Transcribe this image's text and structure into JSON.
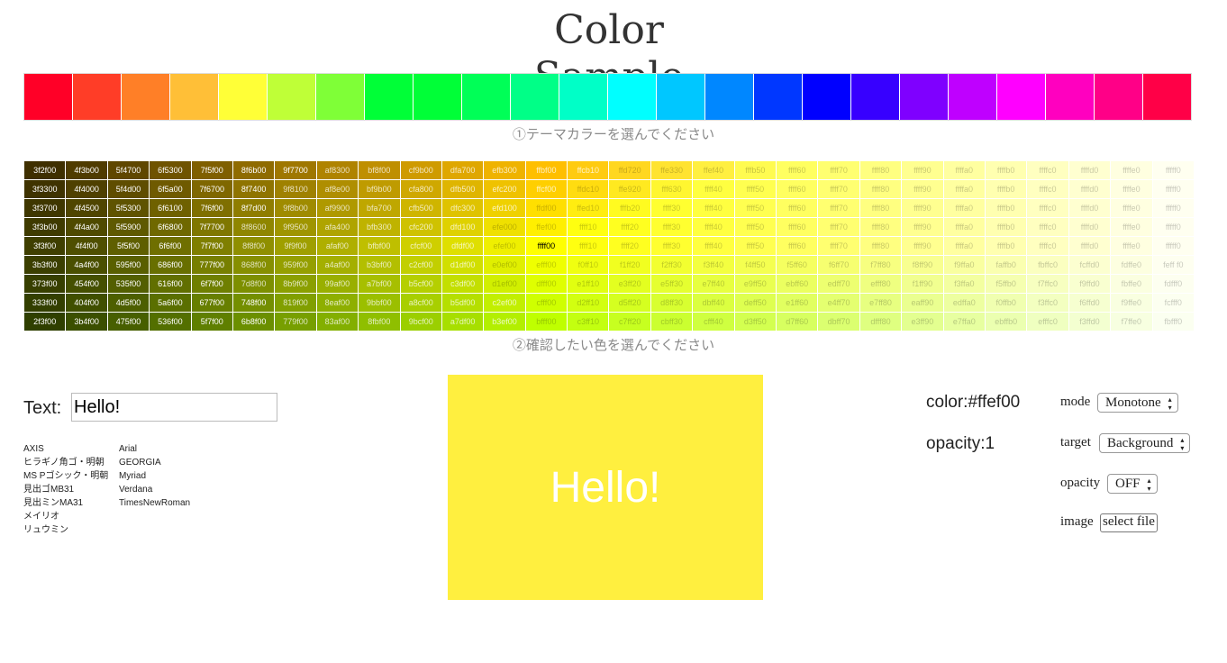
{
  "title": "Color Sample",
  "theme_caption": "①テーマカラーを選んでください",
  "grid_caption": "②確認したい色を選んでください",
  "theme_colors": [
    "#ff0027",
    "#ff3d27",
    "#ff7f27",
    "#ffbf37",
    "#ffff37",
    "#bfff37",
    "#7fff37",
    "#00ff37",
    "#00ff37",
    "#00ff57",
    "#00ff87",
    "#00ffc7",
    "#00ffff",
    "#00c7ff",
    "#0087ff",
    "#0037ff",
    "#0000ff",
    "#3700ff",
    "#7f00ff",
    "#bf00ff",
    "#ff00ff",
    "#ff00bf",
    "#ff0087",
    "#ff0047"
  ],
  "grid_rows": [
    [
      "3f2f00",
      "4f3b00",
      "5f4700",
      "6f5300",
      "7f5f00",
      "8f6b00",
      "9f7700",
      "af8300",
      "bf8f00",
      "cf9b00",
      "dfa700",
      "efb300",
      "ffbf00",
      "ffcb10",
      "ffd720",
      "ffe330",
      "ffef40",
      "fffb50",
      "ffff60",
      "ffff70",
      "ffff80",
      "ffff90",
      "ffffa0",
      "ffffb0",
      "ffffc0",
      "ffffd0",
      "ffffe0",
      "fffff0"
    ],
    [
      "3f3300",
      "4f4000",
      "5f4d00",
      "6f5a00",
      "7f6700",
      "8f7400",
      "9f8100",
      "af8e00",
      "bf9b00",
      "cfa800",
      "dfb500",
      "efc200",
      "ffcf00",
      "ffdc10",
      "ffe920",
      "fff630",
      "ffff40",
      "ffff50",
      "ffff60",
      "ffff70",
      "ffff80",
      "ffff90",
      "ffffa0",
      "ffffb0",
      "ffffc0",
      "ffffd0",
      "ffffe0",
      "fffff0"
    ],
    [
      "3f3700",
      "4f4500",
      "5f5300",
      "6f6100",
      "7f6f00",
      "8f7d00",
      "9f8b00",
      "af9900",
      "bfa700",
      "cfb500",
      "dfc300",
      "efd100",
      "ffdf00",
      "ffed10",
      "fffb20",
      "ffff30",
      "ffff40",
      "ffff50",
      "ffff60",
      "ffff70",
      "ffff80",
      "ffff90",
      "ffffa0",
      "ffffb0",
      "ffffc0",
      "ffffd0",
      "ffffe0",
      "fffff0"
    ],
    [
      "3f3b00",
      "4f4a00",
      "5f5900",
      "6f6800",
      "7f7700",
      "8f8600",
      "9f9500",
      "afa400",
      "bfb300",
      "cfc200",
      "dfd100",
      "efe000",
      "ffef00",
      "ffff10",
      "ffff20",
      "ffff30",
      "ffff40",
      "ffff50",
      "ffff60",
      "ffff70",
      "ffff80",
      "ffff90",
      "ffffa0",
      "ffffb0",
      "ffffc0",
      "ffffd0",
      "ffffe0",
      "fffff0"
    ],
    [
      "3f3f00",
      "4f4f00",
      "5f5f00",
      "6f6f00",
      "7f7f00",
      "8f8f00",
      "9f9f00",
      "afaf00",
      "bfbf00",
      "cfcf00",
      "dfdf00",
      "efef00",
      "ffff00",
      "ffff10",
      "ffff20",
      "ffff30",
      "ffff40",
      "ffff50",
      "ffff60",
      "ffff70",
      "ffff80",
      "ffff90",
      "ffffa0",
      "ffffb0",
      "ffffc0",
      "ffffd0",
      "ffffe0",
      "fffff0"
    ],
    [
      "3b3f00",
      "4a4f00",
      "595f00",
      "686f00",
      "777f00",
      "868f00",
      "959f00",
      "a4af00",
      "b3bf00",
      "c2cf00",
      "d1df00",
      "e0ef00",
      "efff00",
      "f0ff10",
      "f1ff20",
      "f2ff30",
      "f3ff40",
      "f4ff50",
      "f5ff60",
      "f6ff70",
      "f7ff80",
      "f8ff90",
      "f9ffa0",
      "faffb0",
      "fbffc0",
      "fcffd0",
      "fdffe0",
      "feff f0"
    ],
    [
      "373f00",
      "454f00",
      "535f00",
      "616f00",
      "6f7f00",
      "7d8f00",
      "8b9f00",
      "99af00",
      "a7bf00",
      "b5cf00",
      "c3df00",
      "d1ef00",
      "dfff00",
      "e1ff10",
      "e3ff20",
      "e5ff30",
      "e7ff40",
      "e9ff50",
      "ebff60",
      "edff70",
      "efff80",
      "f1ff90",
      "f3ffa0",
      "f5ffb0",
      "f7ffc0",
      "f9ffd0",
      "fbffe0",
      "fdfff0"
    ],
    [
      "333f00",
      "404f00",
      "4d5f00",
      "5a6f00",
      "677f00",
      "748f00",
      "819f00",
      "8eaf00",
      "9bbf00",
      "a8cf00",
      "b5df00",
      "c2ef00",
      "cfff00",
      "d2ff10",
      "d5ff20",
      "d8ff30",
      "dbff40",
      "deff50",
      "e1ff60",
      "e4ff70",
      "e7ff80",
      "eaff90",
      "edffa0",
      "f0ffb0",
      "f3ffc0",
      "f6ffd0",
      "f9ffe0",
      "fcfff0"
    ],
    [
      "2f3f00",
      "3b4f00",
      "475f00",
      "536f00",
      "5f7f00",
      "6b8f00",
      "779f00",
      "83af00",
      "8fbf00",
      "9bcf00",
      "a7df00",
      "b3ef00",
      "bfff00",
      "c3ff10",
      "c7ff20",
      "cbff30",
      "cfff40",
      "d3ff50",
      "d7ff60",
      "dbff70",
      "dfff80",
      "e3ff90",
      "e7ffa0",
      "ebffb0",
      "efffc0",
      "f3ffd0",
      "f7ffe0",
      "fbfff0"
    ]
  ],
  "text_label": "Text:",
  "text_value": "Hello!",
  "fonts_left": [
    "AXIS",
    "ヒラギノ角ゴ・明朝",
    "MS Pゴシック・明朝",
    "見出ゴMB31",
    "見出ミンMA31",
    "メイリオ",
    "リュウミン"
  ],
  "fonts_right": [
    "Arial",
    "GEORGIA",
    "Myriad",
    "Verdana",
    "TimesNewRoman"
  ],
  "preview_text": "Hello!",
  "preview_bg": "#ffef3f",
  "color_readout": "color:#ffef00",
  "opacity_readout": "opacity:1",
  "controls": {
    "mode_label": "mode",
    "mode_value": "Monotone",
    "target_label": "target",
    "target_value": "Background",
    "opacity_label": "opacity",
    "opacity_value": "OFF",
    "image_label": "image",
    "image_button": "select file"
  }
}
